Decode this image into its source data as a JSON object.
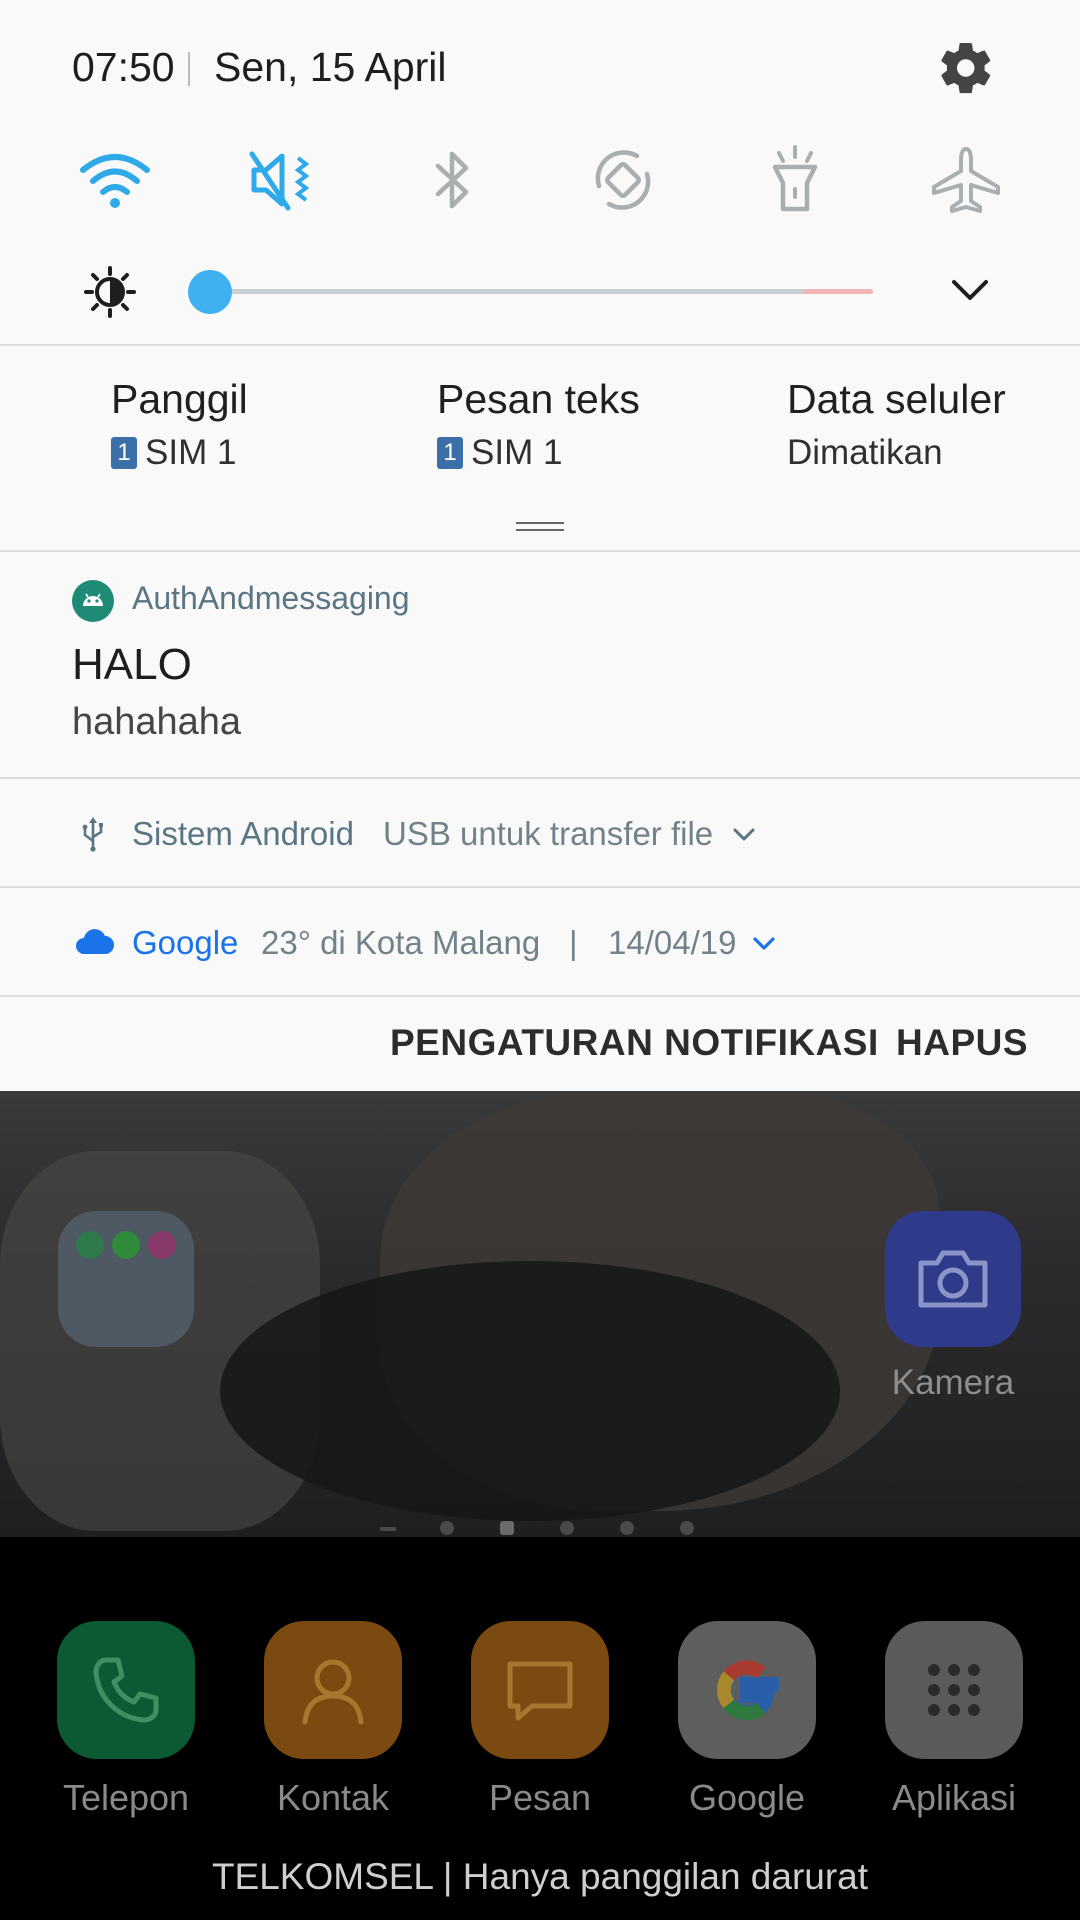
{
  "status": {
    "time": "07:50",
    "date": "Sen, 15 April"
  },
  "quick_settings": {
    "toggles": [
      {
        "name": "wifi-icon",
        "active": true
      },
      {
        "name": "mute-icon",
        "active": true
      },
      {
        "name": "bluetooth-icon",
        "active": false
      },
      {
        "name": "auto-rotate-icon",
        "active": false
      },
      {
        "name": "flashlight-icon",
        "active": false
      },
      {
        "name": "airplane-mode-icon",
        "active": false
      }
    ],
    "brightness_level": 0.0
  },
  "sim": {
    "call": {
      "title": "Panggil",
      "sim_num": "1",
      "sim_label": "SIM 1"
    },
    "sms": {
      "title": "Pesan teks",
      "sim_num": "1",
      "sim_label": "SIM 1"
    },
    "data": {
      "title": "Data seluler",
      "status": "Dimatikan"
    }
  },
  "notifications": {
    "app_notif": {
      "app": "AuthAndmessaging",
      "title": "HALO",
      "body": "hahahaha"
    },
    "system": {
      "app": "Sistem Android",
      "text": "USB untuk transfer file"
    },
    "google": {
      "app": "Google",
      "text": "23° di Kota Malang",
      "sep": "|",
      "date": "14/04/19"
    }
  },
  "actions": {
    "settings_label": "PENGATURAN NOTIFIKASI",
    "clear_label": "HAPUS"
  },
  "home": {
    "kamera_label": "Kamera",
    "dock": [
      "Telepon",
      "Kontak",
      "Pesan",
      "Google",
      "Aplikasi"
    ],
    "carrier_text": "TELKOMSEL | Hanya panggilan darurat"
  },
  "colors": {
    "accent": "#2fa9e8",
    "brightness_knob": "#3fb0f0",
    "google_blue": "#1a73e8"
  }
}
